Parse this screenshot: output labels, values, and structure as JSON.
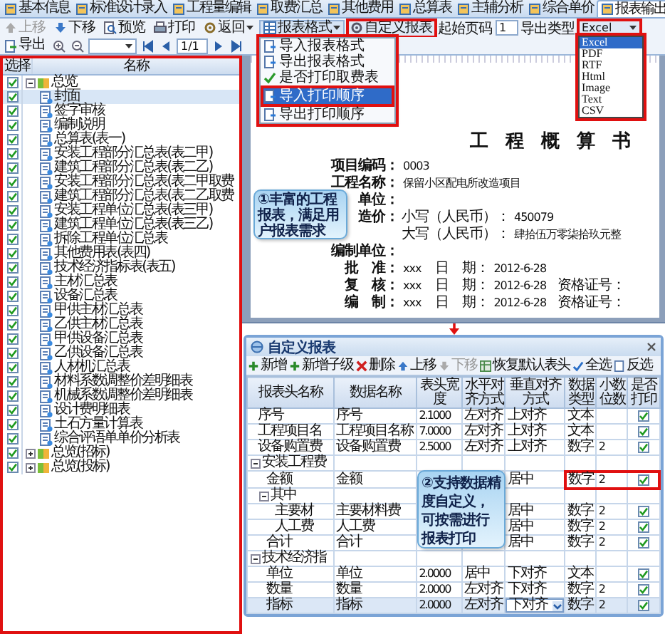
{
  "tabs": [
    {
      "label": "基本信息",
      "selected": false
    },
    {
      "label": "标准设计录入",
      "selected": false
    },
    {
      "label": "工程量编辑",
      "selected": false
    },
    {
      "label": "取费汇总",
      "selected": false
    },
    {
      "label": "其他费用",
      "selected": false
    },
    {
      "label": "总算表",
      "selected": false
    },
    {
      "label": "主辅分析",
      "selected": false
    },
    {
      "label": "综合单价",
      "selected": false
    },
    {
      "label": "报表输出",
      "selected": true
    }
  ],
  "toolbar": {
    "buttons": [
      {
        "label": "上移",
        "disabled": true,
        "dropdown": false
      },
      {
        "label": "下移",
        "disabled": false,
        "dropdown": false
      },
      {
        "label": "预览",
        "disabled": false,
        "dropdown": false
      },
      {
        "label": "打印",
        "disabled": false,
        "dropdown": false
      },
      {
        "label": "返回",
        "disabled": false,
        "dropdown": true
      }
    ],
    "format_menu": {
      "label": "报表格式",
      "expanded": true,
      "highlighted": true,
      "items": [
        {
          "kind": "action",
          "label": "导入报表格式",
          "selected": false,
          "highlighted": false
        },
        {
          "kind": "action",
          "label": "导出报表格式",
          "selected": false,
          "highlighted": false
        },
        {
          "kind": "toggle",
          "label": "是否打印取费表",
          "checked": true,
          "selected": false,
          "highlighted": false
        },
        {
          "kind": "action",
          "label": "导入打印顺序",
          "selected": true,
          "highlighted": true
        },
        {
          "kind": "action",
          "label": "导出打印顺序",
          "selected": false,
          "highlighted": false
        }
      ]
    },
    "custom_report": {
      "label": "自定义报表",
      "highlighted": true
    },
    "start_page": {
      "label": "起始页码",
      "value": "1"
    },
    "export_type": {
      "label": "导出类型",
      "value": "Excel",
      "expanded": true,
      "highlighted": true,
      "options": [
        {
          "label": "Excel",
          "selected": true
        },
        {
          "label": "PDF",
          "selected": false
        },
        {
          "label": "RTF",
          "selected": false
        },
        {
          "label": "Html",
          "selected": false
        },
        {
          "label": "Image",
          "selected": false
        },
        {
          "label": "Text",
          "selected": false
        },
        {
          "label": "CSV",
          "selected": false
        }
      ]
    },
    "export_button": {
      "label": "导出"
    },
    "page_field": {
      "value": "1/1"
    }
  },
  "tree": {
    "highlighted": true,
    "columns": [
      "选择",
      "名称"
    ],
    "items": [
      {
        "label": "总览",
        "checked": true,
        "expanded": true,
        "selected": false,
        "children": [
          {
            "label": "封面",
            "checked": true,
            "selected": true
          },
          {
            "label": "签字审核",
            "checked": true,
            "selected": false
          },
          {
            "label": "编制说明",
            "checked": true,
            "selected": false
          },
          {
            "label": "总算表(表一)",
            "checked": true,
            "selected": false
          },
          {
            "label": "安装工程部分汇总表(表二甲)",
            "checked": true,
            "selected": false
          },
          {
            "label": "建筑工程部分汇总表(表二乙)",
            "checked": true,
            "selected": false
          },
          {
            "label": "安装工程部分汇总表(表二甲取费",
            "checked": true,
            "selected": false
          },
          {
            "label": "建筑工程部分汇总表(表二乙取费",
            "checked": true,
            "selected": false
          },
          {
            "label": "安装工程单位汇总表(表三甲)",
            "checked": true,
            "selected": false
          },
          {
            "label": "建筑工程单位汇总表(表三乙)",
            "checked": true,
            "selected": false
          },
          {
            "label": "拆除工程单位汇总表",
            "checked": true,
            "selected": false
          },
          {
            "label": "其他费用表(表四)",
            "checked": true,
            "selected": false
          },
          {
            "label": "技术经济指标表(表五)",
            "checked": true,
            "selected": false
          },
          {
            "label": "主材汇总表",
            "checked": true,
            "selected": false
          },
          {
            "label": "设备汇总表",
            "checked": true,
            "selected": false
          },
          {
            "label": "甲供主材汇总表",
            "checked": true,
            "selected": false
          },
          {
            "label": "乙供主材汇总表",
            "checked": true,
            "selected": false
          },
          {
            "label": "甲供设备汇总表",
            "checked": true,
            "selected": false
          },
          {
            "label": "乙供设备汇总表",
            "checked": true,
            "selected": false
          },
          {
            "label": "人材机汇总表",
            "checked": true,
            "selected": false
          },
          {
            "label": "材料系数调整价差明细表",
            "checked": true,
            "selected": false
          },
          {
            "label": "机械系数调整价差明细表",
            "checked": true,
            "selected": false
          },
          {
            "label": "设计费明细表",
            "checked": true,
            "selected": false
          },
          {
            "label": "土石方量计算表",
            "checked": true,
            "selected": false
          },
          {
            "label": "综合评语单单价分析表",
            "checked": true,
            "selected": false
          }
        ]
      },
      {
        "label": "总览(招标)",
        "checked": true,
        "expanded": false,
        "selected": false
      },
      {
        "label": "总览(投标)",
        "checked": true,
        "expanded": false,
        "selected": false
      }
    ]
  },
  "document": {
    "title": "工程概算书",
    "rows": [
      {
        "label": "项目编码：",
        "value": "0003"
      },
      {
        "label": "工程名称：",
        "value": "保留小区配电所改造项目"
      },
      {
        "label": "单位："
      },
      {
        "label": "造价：",
        "currency": "小写（人民币）：",
        "value": "450079"
      },
      {
        "currency": "大写（人民币）：",
        "value": "肆拾伍万零柒拾玖元整"
      },
      {
        "label": "编制单位："
      },
      {
        "label": "批　准：",
        "value": "xxx",
        "date_label": "日　期：",
        "date": "2012-6-28"
      },
      {
        "label": "复　核：",
        "value": "xxx",
        "date_label": "日　期：",
        "date": "2012-6-28",
        "cert_label": "资格证号："
      },
      {
        "label": "编　制：",
        "value": "xxx",
        "date_label": "日　期：",
        "date": "2012-6-28",
        "cert_label": "资格证号："
      }
    ],
    "callout": "①丰富的工程报表，满足用户报表需求"
  },
  "dialog": {
    "title": "自定义报表",
    "toolbar": [
      {
        "label": "新增",
        "disabled": false
      },
      {
        "label": "新增子级",
        "disabled": false
      },
      {
        "label": "删除",
        "disabled": false
      },
      {
        "label": "上移",
        "disabled": false
      },
      {
        "label": "下移",
        "disabled": true
      },
      {
        "label": "恢复默认表头",
        "disabled": false
      },
      {
        "label": "全选",
        "disabled": false
      },
      {
        "label": "反选",
        "disabled": false
      }
    ],
    "columns": [
      "报表头名称",
      "数据名称",
      "表头宽度",
      "水平对齐方式",
      "垂直对齐方式",
      "数据类型",
      "小数位数",
      "是否打印"
    ],
    "rows": [
      {
        "name": "序号",
        "data": "序号",
        "header_value": "2.1000",
        "halign": "左对齐",
        "valign": "上对齐",
        "type": "文本",
        "checked": true,
        "selected": false,
        "highlighted": false
      },
      {
        "name": "工程项目名",
        "data": "工程项目名称",
        "header_value": "7.0000",
        "halign": "左对齐",
        "valign": "上对齐",
        "type": "文本",
        "checked": true,
        "selected": false,
        "highlighted": false
      },
      {
        "name": "设备购置费",
        "data": "设备购置费",
        "header_value": "2.5000",
        "halign": "左对齐",
        "valign": "上对齐",
        "type": "数字",
        "decimals": "2",
        "checked": true,
        "selected": false,
        "highlighted": false
      },
      {
        "name": "安装工程费",
        "expanded": true,
        "selected": false,
        "highlighted": false,
        "children": [
          {
            "name": "金额",
            "data": "金额",
            "valign": "居中",
            "type": "数字",
            "decimals": "2",
            "checked": true,
            "selected": false,
            "highlighted": true
          },
          {
            "name": "其中",
            "expanded": true,
            "selected": false,
            "highlighted": false,
            "children": [
              {
                "name": "主要材",
                "data": "主要材料费",
                "valign": "居中",
                "type": "数字",
                "decimals": "2",
                "checked": true,
                "selected": false,
                "highlighted": false
              },
              {
                "name": "人工费",
                "data": "人工费",
                "valign": "居中",
                "type": "数字",
                "decimals": "2",
                "checked": true,
                "selected": false,
                "highlighted": false
              }
            ]
          },
          {
            "name": "合计",
            "data": "合计",
            "valign": "居中",
            "type": "数字",
            "decimals": "2",
            "checked": true,
            "selected": false,
            "highlighted": false
          }
        ]
      },
      {
        "name": "技术经济指",
        "expanded": true,
        "selected": false,
        "highlighted": false,
        "children": [
          {
            "name": "单位",
            "data": "单位",
            "header_value": "2.0000",
            "halign": "居中",
            "valign": "下对齐",
            "type": "文本",
            "checked": true,
            "selected": false,
            "highlighted": false
          },
          {
            "name": "数量",
            "data": "数量",
            "header_value": "2.0000",
            "halign": "左对齐",
            "valign": "下对齐",
            "type": "数字",
            "decimals": "2",
            "checked": true,
            "selected": false,
            "highlighted": false
          },
          {
            "name": "指标",
            "data": "指标",
            "header_value": "2.0000",
            "halign": "左对齐",
            "valign": "下对齐",
            "type": "数字",
            "decimals": "2",
            "checked": true,
            "selected": true,
            "highlighted": false
          }
        ]
      }
    ],
    "callout": "②支持数据精度自定义，可按需进行报表打印"
  }
}
